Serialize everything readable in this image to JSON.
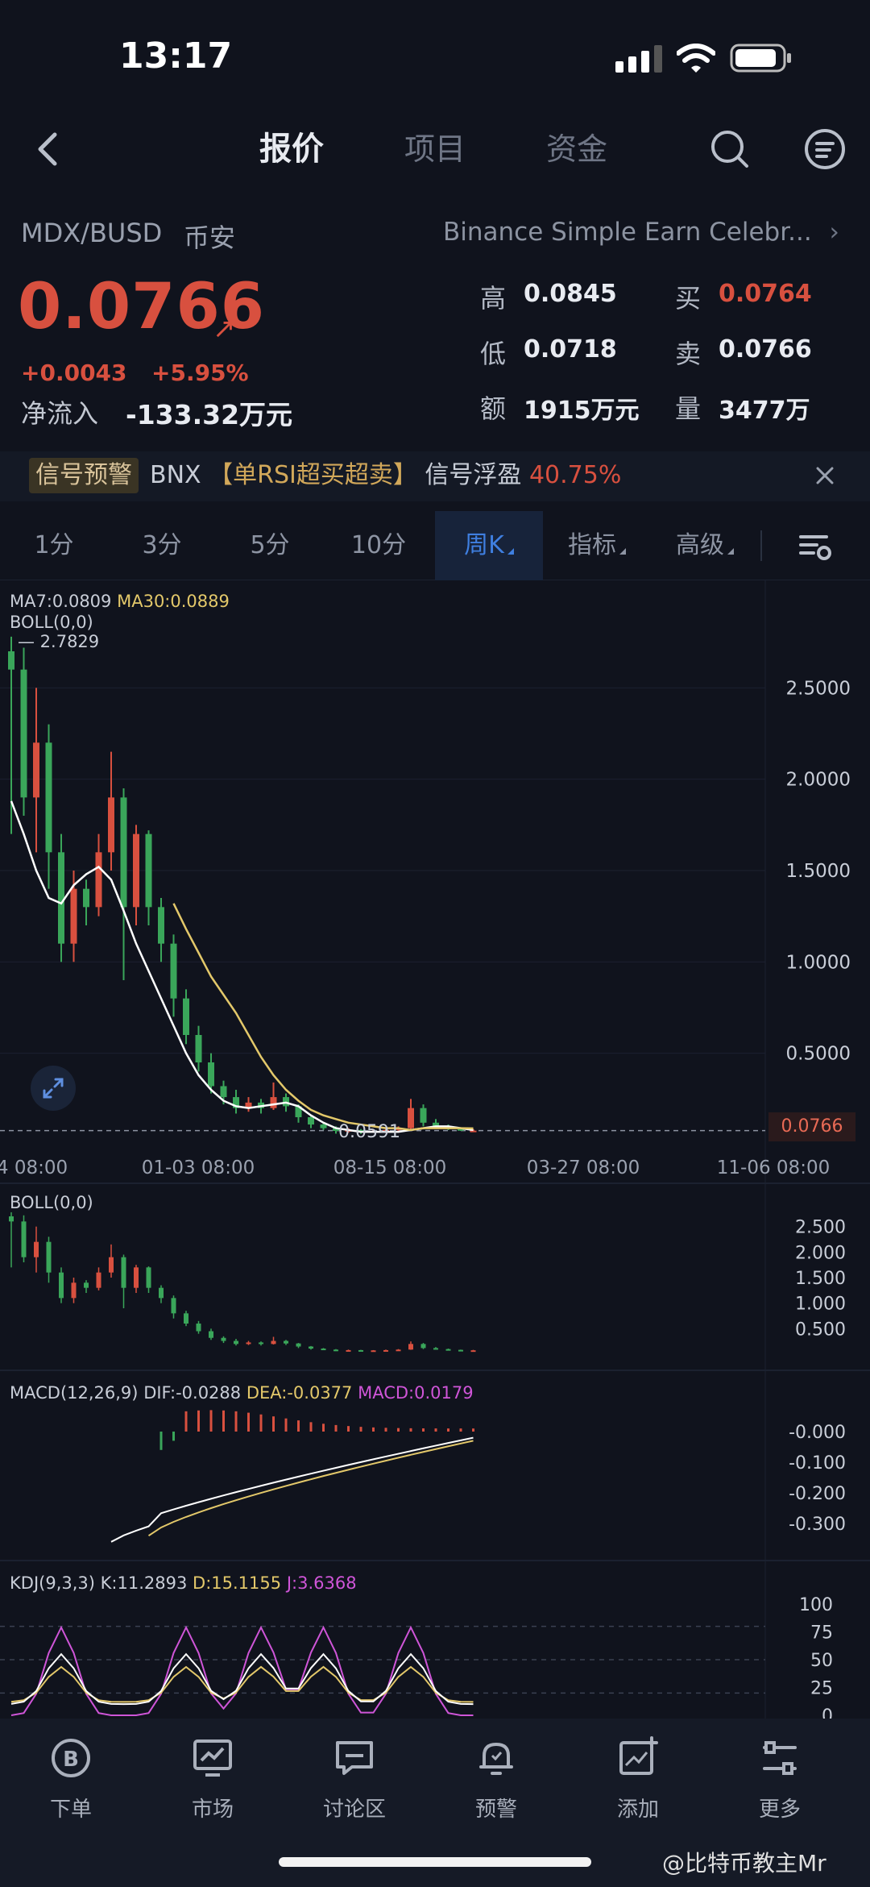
{
  "status": {
    "time": "13:17"
  },
  "header": {
    "tabs": [
      {
        "label": "报价",
        "active": true
      },
      {
        "label": "项目",
        "active": false
      },
      {
        "label": "资金",
        "active": false
      }
    ]
  },
  "market": {
    "pair": "MDX/BUSD",
    "exchange": "币安",
    "banner": "Binance Simple Earn Celebr...",
    "banner_chevron": "›",
    "price": "0.0766",
    "price_arrow": "↗",
    "change_abs": "+0.0043",
    "change_pct": "+5.95%",
    "netflow_label": "净流入",
    "netflow_value": "-133.32万元",
    "stats": {
      "high_label": "高",
      "high": "0.0845",
      "low_label": "低",
      "low": "0.0718",
      "amount_label": "额",
      "amount": "1915万元",
      "bid_label": "买",
      "bid": "0.0764",
      "ask_label": "卖",
      "ask": "0.0766",
      "volume_label": "量",
      "volume": "3477万"
    }
  },
  "signal": {
    "tag": "信号预警",
    "coin": "BNX",
    "bracket_text": "【单RSI超买超卖】",
    "status_text": "信号浮盈",
    "profit": "40.75%"
  },
  "intervals": {
    "items": [
      {
        "label": "1分",
        "active": false,
        "dropdown": false
      },
      {
        "label": "3分",
        "active": false,
        "dropdown": false
      },
      {
        "label": "5分",
        "active": false,
        "dropdown": false
      },
      {
        "label": "10分",
        "active": false,
        "dropdown": false
      },
      {
        "label": "周K",
        "active": true,
        "dropdown": true
      },
      {
        "label": "指标",
        "active": false,
        "dropdown": true
      },
      {
        "label": "高级",
        "active": false,
        "dropdown": true
      }
    ]
  },
  "indicators": {
    "ma7_label": "MA7:0.0809",
    "ma30_label": "MA30:0.0889",
    "boll_label": "BOLL(0,0)",
    "max_marker": "— 2.7829",
    "min_marker": "0.0591",
    "current_price_tag": "0.0766",
    "boll2_label": "BOLL(0,0)",
    "macd_label": "MACD(12,26,9)",
    "macd_dif": "DIF:-0.0288",
    "macd_dea": "DEA:-0.0377",
    "macd_val": "MACD:0.0179",
    "kdj_label": "KDJ(9,3,3)",
    "kdj_k": "K:11.2893",
    "kdj_d": "D:15.1155",
    "kdj_j": "J:3.6368"
  },
  "chart_data": [
    {
      "type": "candlestick",
      "title": "",
      "x_ticks": [
        "4 08:00",
        "01-03 08:00",
        "08-15 08:00",
        "03-27 08:00",
        "11-06 08:00"
      ],
      "y_ticks": [
        2.5,
        2.0,
        1.5,
        1.0,
        0.5
      ],
      "ylim": [
        0,
        3.0
      ],
      "max_value": 2.7829,
      "min_value": 0.0591,
      "last_price": 0.0766,
      "grid": true,
      "series": [
        {
          "name": "MA7",
          "color": "#ffffff",
          "values": [
            1.88,
            1.7,
            1.5,
            1.35,
            1.32,
            1.42,
            1.48,
            1.52,
            1.45,
            1.28,
            1.1,
            0.95,
            0.8,
            0.65,
            0.5,
            0.38,
            0.3,
            0.24,
            0.21,
            0.2,
            0.21,
            0.22,
            0.23,
            0.21,
            0.16,
            0.12,
            0.09,
            0.08,
            0.07,
            0.07,
            0.07,
            0.07,
            0.08,
            0.09,
            0.1,
            0.1,
            0.09,
            0.08
          ]
        },
        {
          "name": "MA30",
          "color": "#e3c86a",
          "start_index": 13,
          "values": [
            1.32,
            1.18,
            1.05,
            0.92,
            0.82,
            0.72,
            0.6,
            0.48,
            0.38,
            0.3,
            0.24,
            0.19,
            0.16,
            0.14,
            0.12,
            0.11,
            0.1,
            0.09,
            0.09,
            0.08,
            0.09,
            0.09,
            0.09,
            0.09,
            0.089
          ]
        }
      ],
      "candles": [
        [
          0.0,
          2.7,
          2.6,
          2.78,
          1.7
        ],
        [
          1.0,
          2.6,
          1.9,
          2.72,
          1.8
        ],
        [
          2.0,
          1.9,
          2.2,
          2.5,
          1.6
        ],
        [
          3.0,
          2.2,
          1.6,
          2.3,
          1.4
        ],
        [
          4.0,
          1.6,
          1.1,
          1.7,
          1.0
        ],
        [
          5.0,
          1.1,
          1.4,
          1.5,
          1.0
        ],
        [
          6.0,
          1.4,
          1.3,
          1.45,
          1.2
        ],
        [
          7.0,
          1.3,
          1.6,
          1.7,
          1.25
        ],
        [
          8.0,
          1.6,
          1.9,
          2.15,
          1.5
        ],
        [
          9.0,
          1.9,
          1.3,
          1.95,
          0.9
        ],
        [
          10.0,
          1.3,
          1.7,
          1.75,
          1.2
        ],
        [
          11.0,
          1.7,
          1.3,
          1.72,
          1.2
        ],
        [
          12.0,
          1.3,
          1.1,
          1.35,
          1.0
        ],
        [
          13.0,
          1.1,
          0.8,
          1.15,
          0.7
        ],
        [
          14.0,
          0.8,
          0.6,
          0.85,
          0.55
        ],
        [
          15.0,
          0.6,
          0.45,
          0.65,
          0.4
        ],
        [
          16.0,
          0.45,
          0.32,
          0.5,
          0.28
        ],
        [
          17.0,
          0.32,
          0.26,
          0.35,
          0.22
        ],
        [
          18.0,
          0.26,
          0.2,
          0.3,
          0.17
        ],
        [
          19.0,
          0.2,
          0.23,
          0.26,
          0.18
        ],
        [
          20.0,
          0.23,
          0.2,
          0.25,
          0.17
        ],
        [
          21.0,
          0.2,
          0.26,
          0.34,
          0.19
        ],
        [
          22.0,
          0.26,
          0.21,
          0.28,
          0.18
        ],
        [
          23.0,
          0.21,
          0.15,
          0.22,
          0.12
        ],
        [
          24.0,
          0.15,
          0.11,
          0.16,
          0.09
        ],
        [
          25.0,
          0.11,
          0.09,
          0.12,
          0.08
        ],
        [
          26.0,
          0.09,
          0.075,
          0.1,
          0.06
        ],
        [
          27.0,
          0.075,
          0.08,
          0.09,
          0.065
        ],
        [
          28.0,
          0.08,
          0.07,
          0.085,
          0.0591
        ],
        [
          29.0,
          0.07,
          0.075,
          0.08,
          0.065
        ],
        [
          30.0,
          0.075,
          0.08,
          0.09,
          0.07
        ],
        [
          31.0,
          0.08,
          0.09,
          0.1,
          0.075
        ],
        [
          32.0,
          0.09,
          0.2,
          0.25,
          0.085
        ],
        [
          33.0,
          0.2,
          0.12,
          0.22,
          0.1
        ],
        [
          34.0,
          0.12,
          0.1,
          0.14,
          0.09
        ],
        [
          35.0,
          0.1,
          0.085,
          0.11,
          0.08
        ],
        [
          36.0,
          0.085,
          0.08,
          0.09,
          0.075
        ],
        [
          37.0,
          0.073,
          0.0766,
          0.0845,
          0.0718
        ]
      ]
    },
    {
      "type": "candlestick",
      "title": "BOLL(0,0)",
      "y_ticks": [
        2.5,
        2.0,
        1.5,
        1.0,
        0.5
      ]
    },
    {
      "type": "bar",
      "title": "MACD(12,26,9)",
      "y_ticks": [
        -0.0,
        -0.1,
        -0.2,
        -0.3
      ],
      "series": [
        {
          "name": "DIF",
          "color": "#ffffff"
        },
        {
          "name": "DEA",
          "color": "#e3c86a"
        },
        {
          "name": "MACD",
          "color": "#cf55d8"
        }
      ]
    },
    {
      "type": "line",
      "title": "KDJ(9,3,3)",
      "y_ticks": [
        100,
        75,
        50,
        25,
        0
      ],
      "series": [
        {
          "name": "K",
          "color": "#ffffff"
        },
        {
          "name": "D",
          "color": "#e3c86a"
        },
        {
          "name": "J",
          "color": "#cf55d8"
        }
      ]
    }
  ],
  "bottom_nav": {
    "items": [
      {
        "label": "下单"
      },
      {
        "label": "市场"
      },
      {
        "label": "讨论区"
      },
      {
        "label": "预警"
      },
      {
        "label": "添加"
      },
      {
        "label": "更多"
      }
    ]
  },
  "watermark": "@比特币教主Mr",
  "colors": {
    "up": "#d8503f",
    "down": "#3aa65a",
    "accent": "#3f7fe0",
    "ma30": "#e3c86a"
  }
}
